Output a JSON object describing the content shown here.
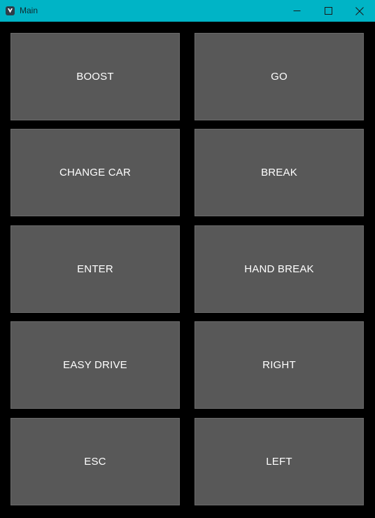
{
  "window": {
    "title": "Main",
    "titlebar_color": "#00b4c6",
    "controls": {
      "minimize_icon": "minimize-icon",
      "maximize_icon": "maximize-icon",
      "close_icon": "close-icon"
    }
  },
  "buttons": {
    "boost": "BOOST",
    "go": "GO",
    "change_car": "CHANGE CAR",
    "break": "BREAK",
    "enter": "ENTER",
    "hand_break": "HAND BREAK",
    "easy_drive": "EASY DRIVE",
    "right": "RIGHT",
    "esc": "ESC",
    "left": "LEFT"
  },
  "colors": {
    "background": "#000000",
    "button_fill": "#585858",
    "button_text": "#ffffff"
  }
}
